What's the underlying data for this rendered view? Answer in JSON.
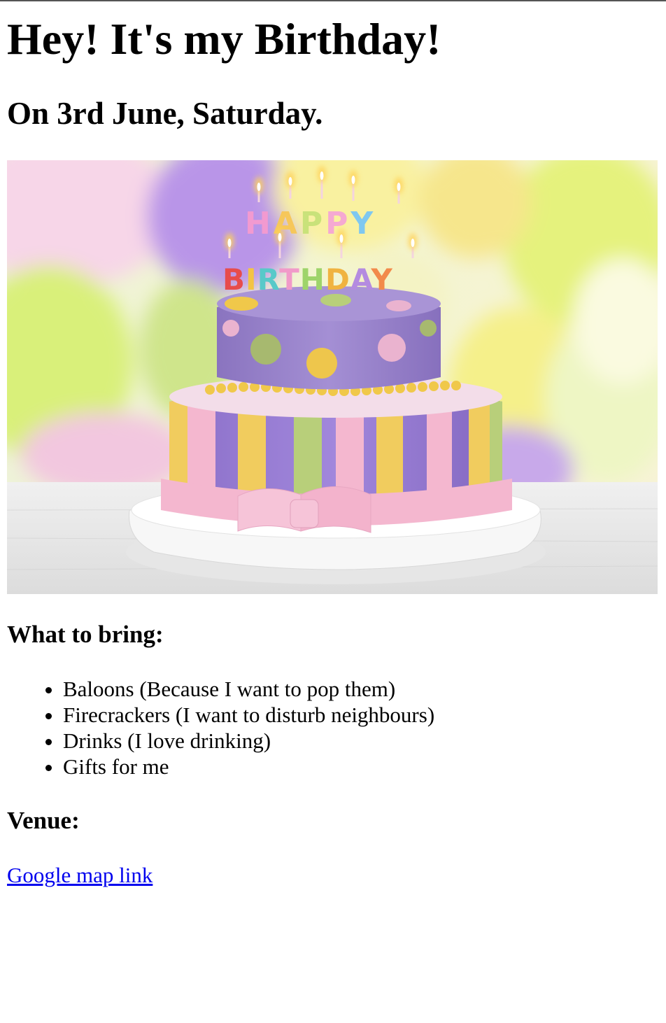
{
  "header": {
    "title": "Hey! It's my Birthday!",
    "subtitle": "On 3rd June, Saturday."
  },
  "image": {
    "description_icon": "birthday-cake-image",
    "candle_text_top": "HAPPY",
    "candle_text_bottom": "BIRTHDAY",
    "colors": {
      "cake_purple": "#9b84c9",
      "stripe_yellow": "#f1cc5e",
      "stripe_green": "#b8cf7a",
      "ribbon_pink": "#f4b7cf",
      "balloon_green": "#d9f07a",
      "balloon_purple": "#b995e8",
      "balloon_yellow": "#f6ef86"
    }
  },
  "bring": {
    "title": "What to bring:",
    "items": [
      "Baloons (Because I want to pop them)",
      "Firecrackers (I want to disturb neighbours)",
      "Drinks (I love drinking)",
      "Gifts for me"
    ]
  },
  "venue": {
    "title": "Venue:",
    "link_label": "Google map link",
    "link_color": "#0000ee"
  }
}
